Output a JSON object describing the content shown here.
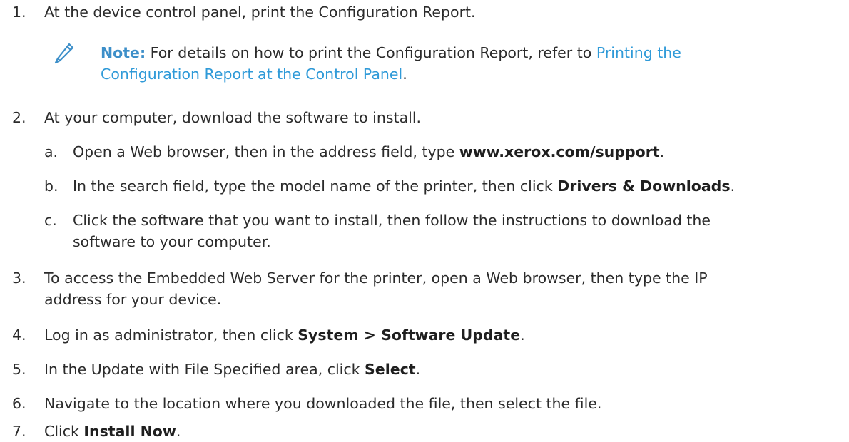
{
  "steps": [
    {
      "num": "1.",
      "text": "At the device control panel, print the Configuration Report."
    },
    {
      "num": "2.",
      "text": "At your computer, download the software to install."
    },
    {
      "num": "3.",
      "line1": "To access the Embedded Web Server for the printer, open a Web browser, then type the IP",
      "line2": "address for your device."
    },
    {
      "num": "4.",
      "pre": "Log in as administrator, then click ",
      "bold": "System > Software Update",
      "post": "."
    },
    {
      "num": "5.",
      "pre": "In the Update with File Specified area, click ",
      "bold": "Select",
      "post": "."
    },
    {
      "num": "6.",
      "text": "Navigate to the location where you downloaded the file, then select the file."
    },
    {
      "num": "7.",
      "pre": "Click ",
      "bold": "Install Now",
      "post": "."
    }
  ],
  "note": {
    "icon": "pencil-icon",
    "label": "Note:",
    "text": " For details on how to print the Configuration Report, refer to ",
    "link_line1": "Printing the",
    "link_line2": "Configuration Report at the Control Panel",
    "end": "."
  },
  "substeps": [
    {
      "letter": "a.",
      "pre": "Open a Web browser, then in the address field, type ",
      "bold": "www.xerox.com/support",
      "post": "."
    },
    {
      "letter": "b.",
      "pre": "In the search field, type the model name of the printer, then click ",
      "bold": "Drivers & Downloads",
      "post": "."
    },
    {
      "letter": "c.",
      "line1": "Click the software that you want to install, then follow the instructions to download the",
      "line2": "software to your computer."
    }
  ],
  "colors": {
    "note_label": "#3d8fc9",
    "link": "#2f9ad8",
    "text": "#2b2b2b"
  }
}
